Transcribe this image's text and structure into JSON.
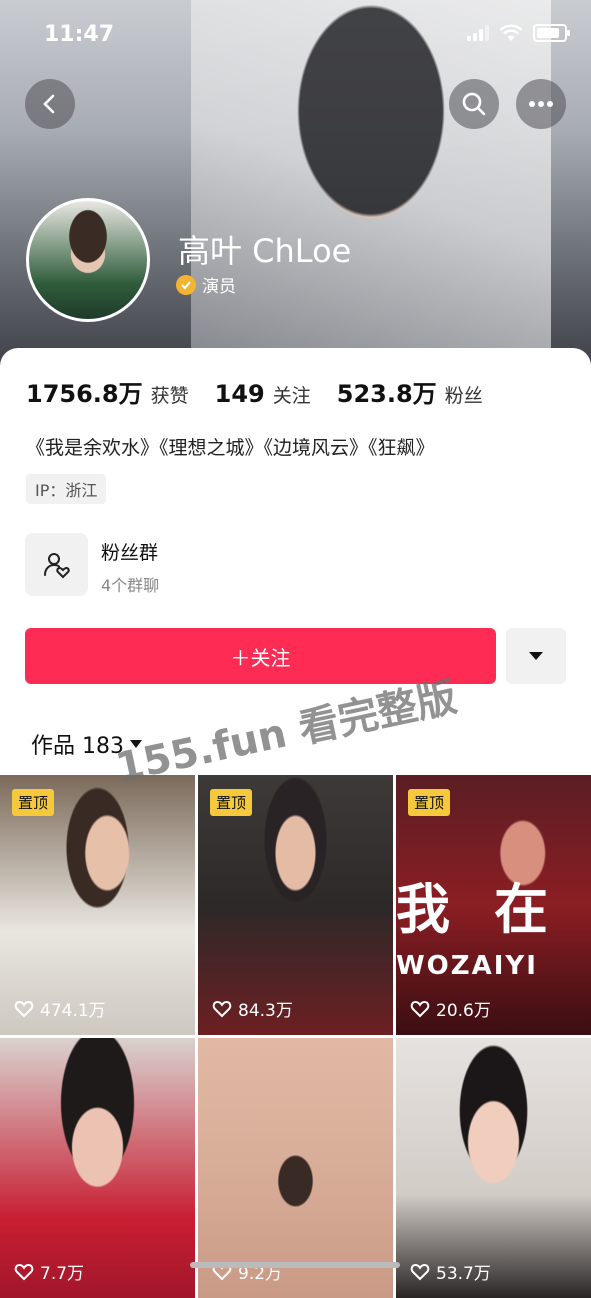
{
  "status_bar": {
    "time": "11:47"
  },
  "profile": {
    "name": "高叶 ChLoe",
    "verify_label": "演员",
    "ip": "IP：浙江",
    "works_line": "《我是余欢水》《理想之城》《边境风云》《狂飙》"
  },
  "stats": [
    {
      "value": "1756.8万",
      "label": "获赞"
    },
    {
      "value": "149",
      "label": "关注"
    },
    {
      "value": "523.8万",
      "label": "粉丝"
    }
  ],
  "fan_group": {
    "title": "粉丝群",
    "subtitle": "4个群聊"
  },
  "actions": {
    "follow_label": "＋关注"
  },
  "tabs": {
    "works_label": "作品 183"
  },
  "watermark": "155.fun 看完整版",
  "videos": [
    {
      "pinned": true,
      "pin_label": "置顶",
      "likes": "474.1万"
    },
    {
      "pinned": true,
      "pin_label": "置顶",
      "likes": "84.3万"
    },
    {
      "pinned": true,
      "pin_label": "置顶",
      "likes": "20.6万",
      "overlay_left": "我",
      "overlay_right": "在",
      "overlay_sub": "WOZAIYI"
    },
    {
      "pinned": false,
      "likes": "7.7万"
    },
    {
      "pinned": false,
      "likes": "9.2万"
    },
    {
      "pinned": false,
      "likes": "53.7万"
    }
  ],
  "colors": {
    "accent": "#fe2c55",
    "pin": "#f6c93c",
    "verify": "#f3b531"
  }
}
